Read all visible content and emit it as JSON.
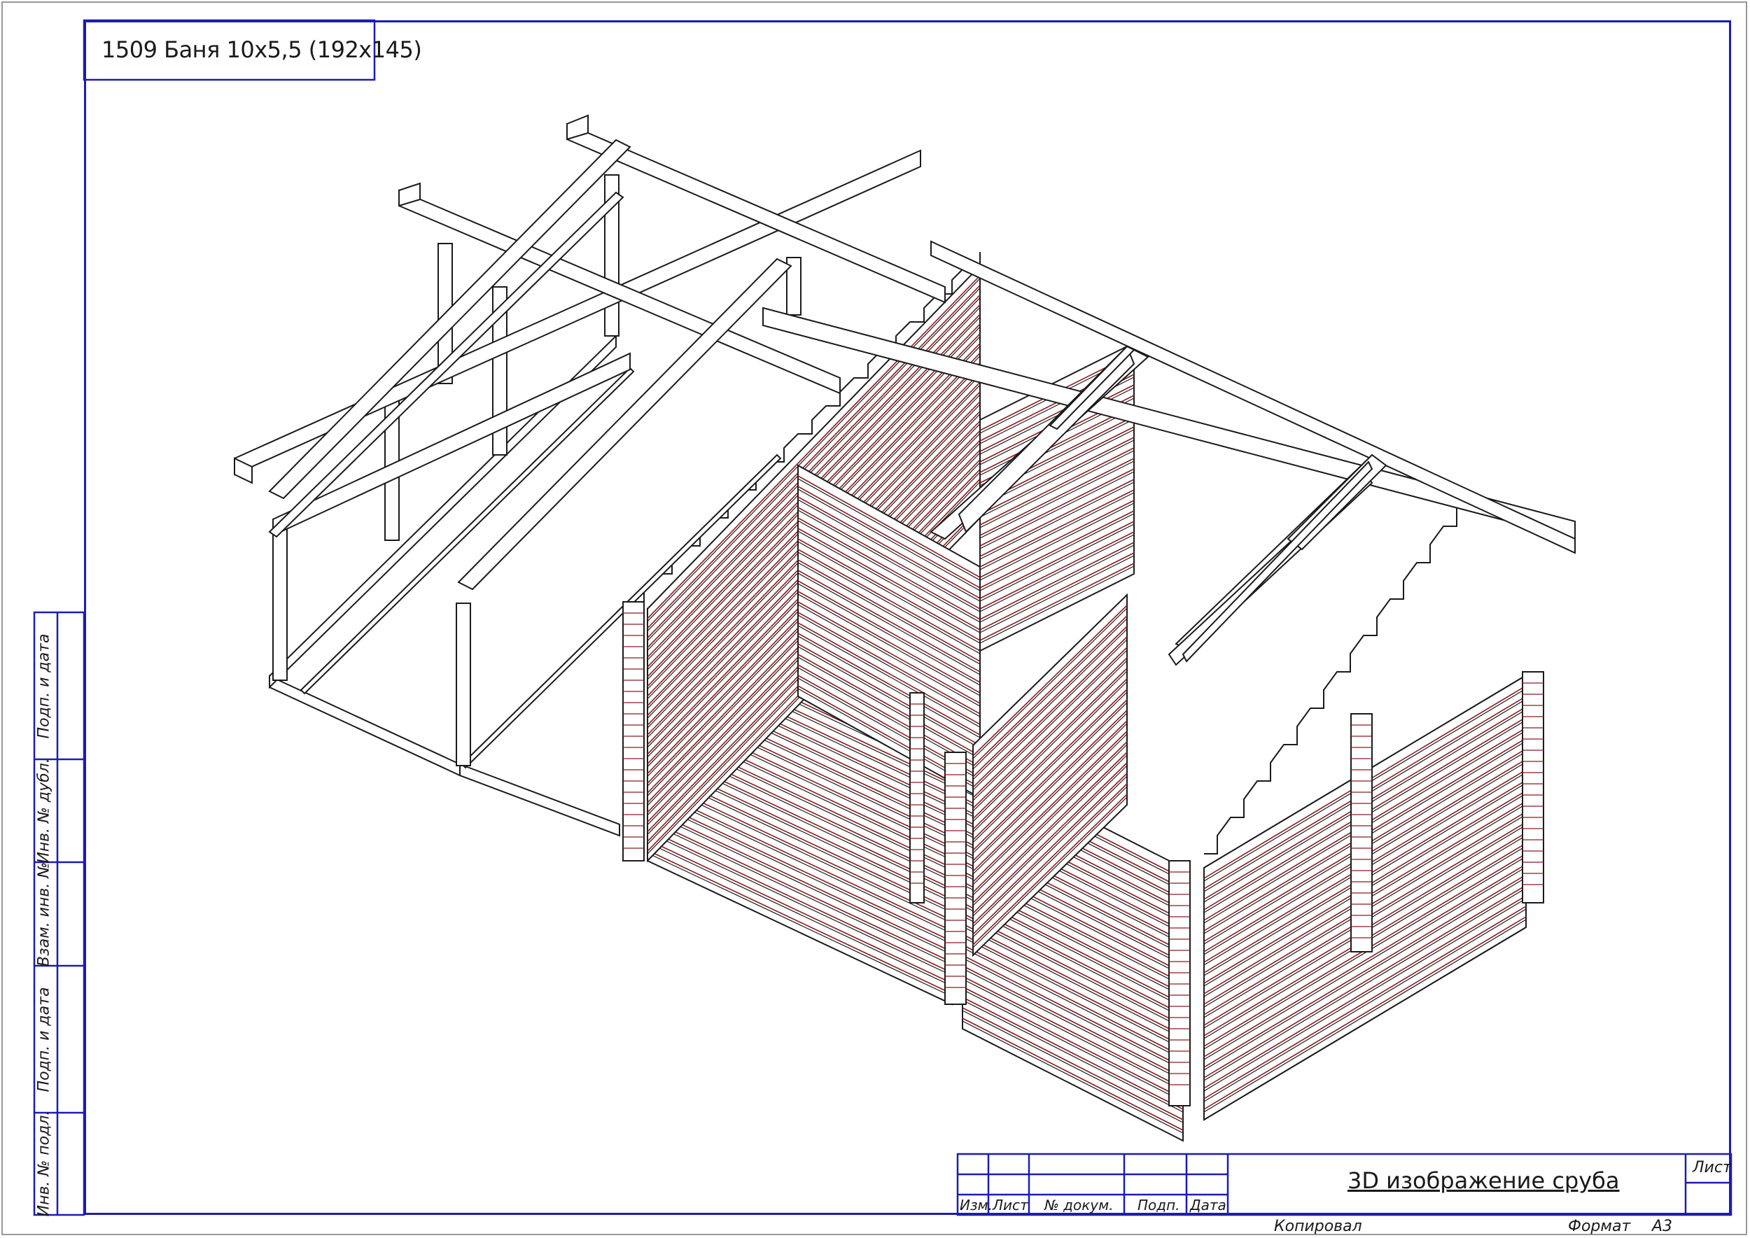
{
  "sheet": {
    "title_stamp": "1509 Баня 10х5,5 (192х145)",
    "drawing_title": "3D изображение сруба",
    "sheet_label": "Лист",
    "copied_label": "Копировал",
    "format_label": "Формат",
    "format_value": "А3"
  },
  "title_block_headers": [
    "Изм.",
    "Лист",
    "№ докум.",
    "Подп.",
    "Дата"
  ],
  "side_strip": [
    "Подп. и дата",
    "Инв. № дубл.",
    "Взам. инв. №",
    "Подп. и дата",
    "Инв. № подл."
  ],
  "colors": {
    "frame": "#1c1cb4",
    "log_line": "#1a1a1a",
    "log_seam": "#8b1a1a",
    "border_outer": "#999999"
  }
}
